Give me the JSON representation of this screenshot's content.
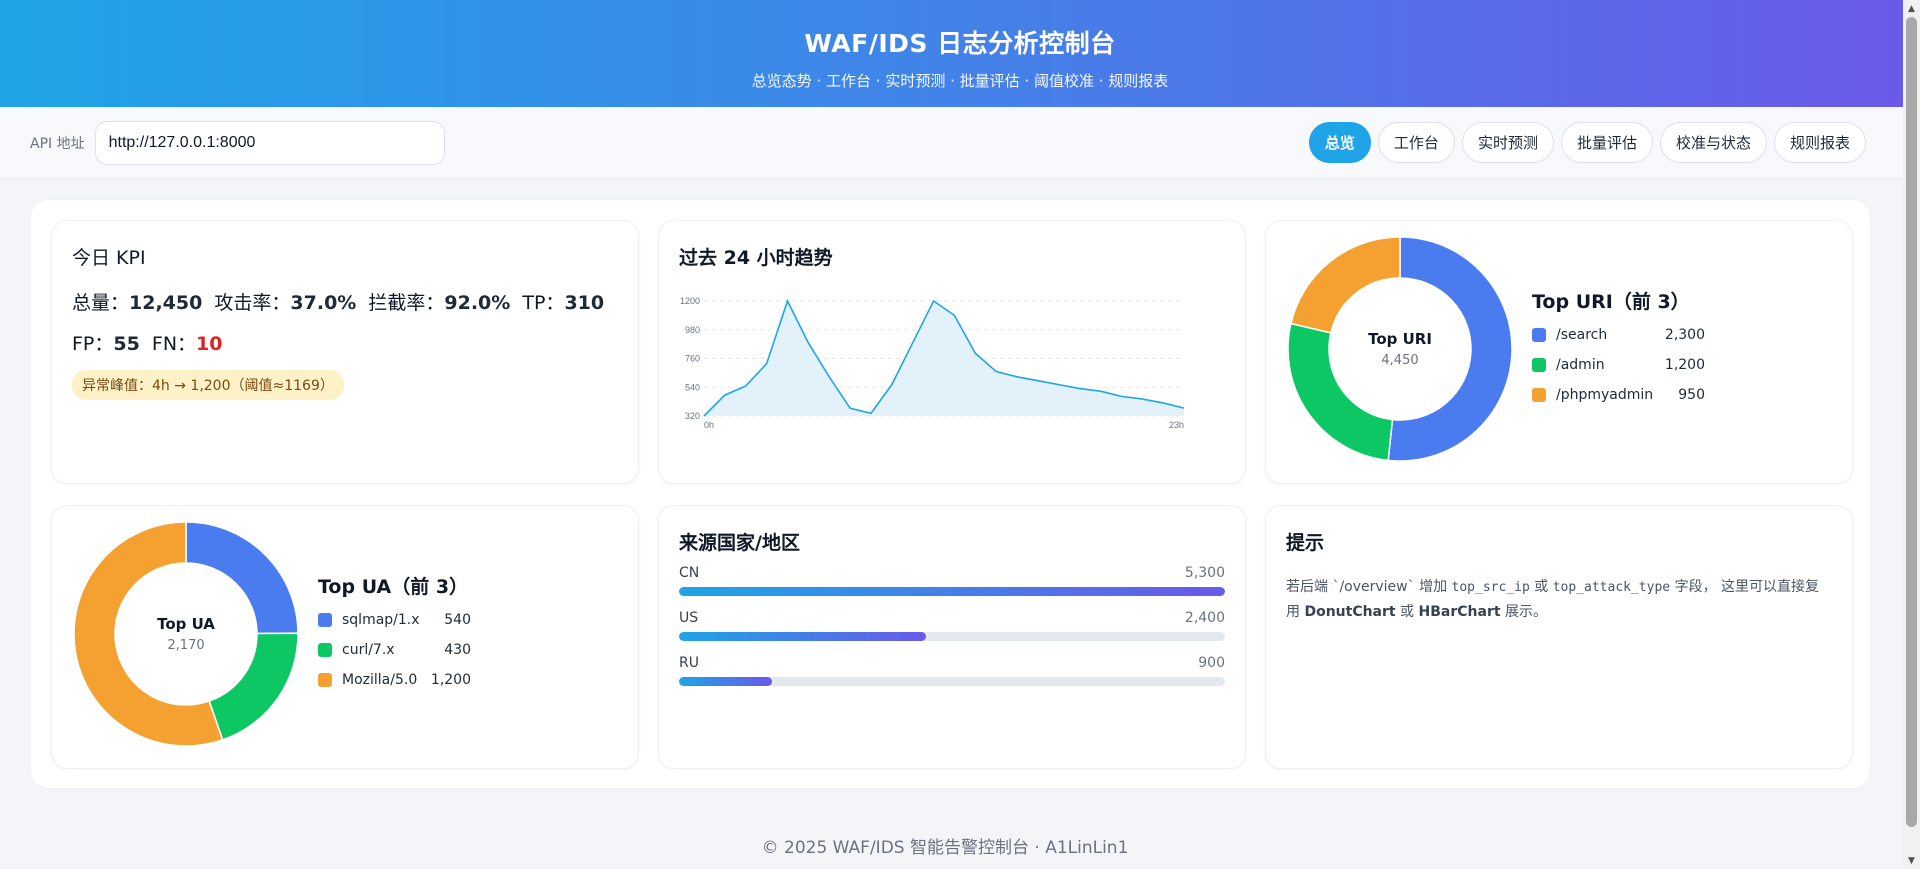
{
  "header": {
    "title": "WAF/IDS 日志分析控制台",
    "subtitle": "总览态势 · 工作台 · 实时预测 · 批量评估 · 阈值校准 · 规则报表"
  },
  "toolbar": {
    "api_label": "API 地址",
    "api_value": "http://127.0.0.1:8000",
    "nav": [
      "总览",
      "工作台",
      "实时预测",
      "批量评估",
      "校准与状态",
      "规则报表"
    ],
    "active_nav": "总览"
  },
  "kpi": {
    "title": "今日 KPI",
    "total_label": "总量：",
    "total": "12,450",
    "attack_rate_label": "攻击率：",
    "attack_rate": "37.0%",
    "block_rate_label": "拦截率：",
    "block_rate": "92.0%",
    "tp_label": "TP：",
    "tp": "310",
    "fp_label": "FP：",
    "fp": "55",
    "fn_label": "FN：",
    "fn": "10",
    "anomaly": "异常峰值：4h → 1,200（阈值≈1169）"
  },
  "trend": {
    "title": "过去 24 小时趋势"
  },
  "uri": {
    "center_title": "Top URI",
    "center_value": "4,450",
    "legend_title": "Top URI（前 3）"
  },
  "ua": {
    "center_title": "Top UA",
    "center_value": "2,170",
    "legend_title": "Top UA（前 3）"
  },
  "geo": {
    "title": "来源国家/地区",
    "items": [
      {
        "name": "CN",
        "value": "5,300"
      },
      {
        "name": "US",
        "value": "2,400"
      },
      {
        "name": "RU",
        "value": "900"
      }
    ]
  },
  "tips": {
    "title": "提示",
    "p1": "若后端 `/overview` 增加 ",
    "c1": "top_src_ip",
    "p2": " 或 ",
    "c2": "top_attack_type",
    "p3": " 字段， 这里可以直接复用 ",
    "b1": "DonutChart",
    "p4": " 或 ",
    "b2": "HBarChart",
    "p5": " 展示。"
  },
  "footer": "© 2025 WAF/IDS 智能告警控制台 · A1LinLin1",
  "colors": {
    "accent": "#1ea4e7",
    "blue": "#4a7cf0",
    "green": "#0cc763",
    "orange": "#f5a132",
    "danger": "#e02424"
  },
  "chart_data": [
    {
      "type": "area",
      "x": [
        "0h",
        "1h",
        "2h",
        "3h",
        "4h",
        "5h",
        "6h",
        "7h",
        "8h",
        "9h",
        "10h",
        "11h",
        "12h",
        "13h",
        "14h",
        "15h",
        "16h",
        "17h",
        "18h",
        "19h",
        "20h",
        "21h",
        "22h",
        "23h"
      ],
      "values": [
        320,
        480,
        550,
        720,
        1200,
        880,
        620,
        380,
        340,
        560,
        880,
        1200,
        1090,
        800,
        660,
        620,
        590,
        560,
        530,
        510,
        470,
        450,
        420,
        380
      ],
      "ylim": [
        320,
        1200
      ],
      "yticks": [
        320,
        540,
        760,
        980,
        1200
      ],
      "xtick_labels": [
        "0h",
        "23h"
      ],
      "grid": "horizontal dashed"
    },
    {
      "type": "pie",
      "categories": [
        "/search",
        "/admin",
        "/phpmyadmin"
      ],
      "values": [
        2300,
        1200,
        950
      ],
      "value_labels": [
        "2,300",
        "1,200",
        "950"
      ]
    },
    {
      "type": "pie",
      "categories": [
        "sqlmap/1.x",
        "curl/7.x",
        "Mozilla/5.0"
      ],
      "values": [
        540,
        430,
        1200
      ],
      "value_labels": [
        "540",
        "430",
        "1,200"
      ]
    },
    {
      "type": "bar",
      "categories": [
        "CN",
        "US",
        "RU"
      ],
      "values": [
        5300,
        2400,
        900
      ]
    }
  ]
}
